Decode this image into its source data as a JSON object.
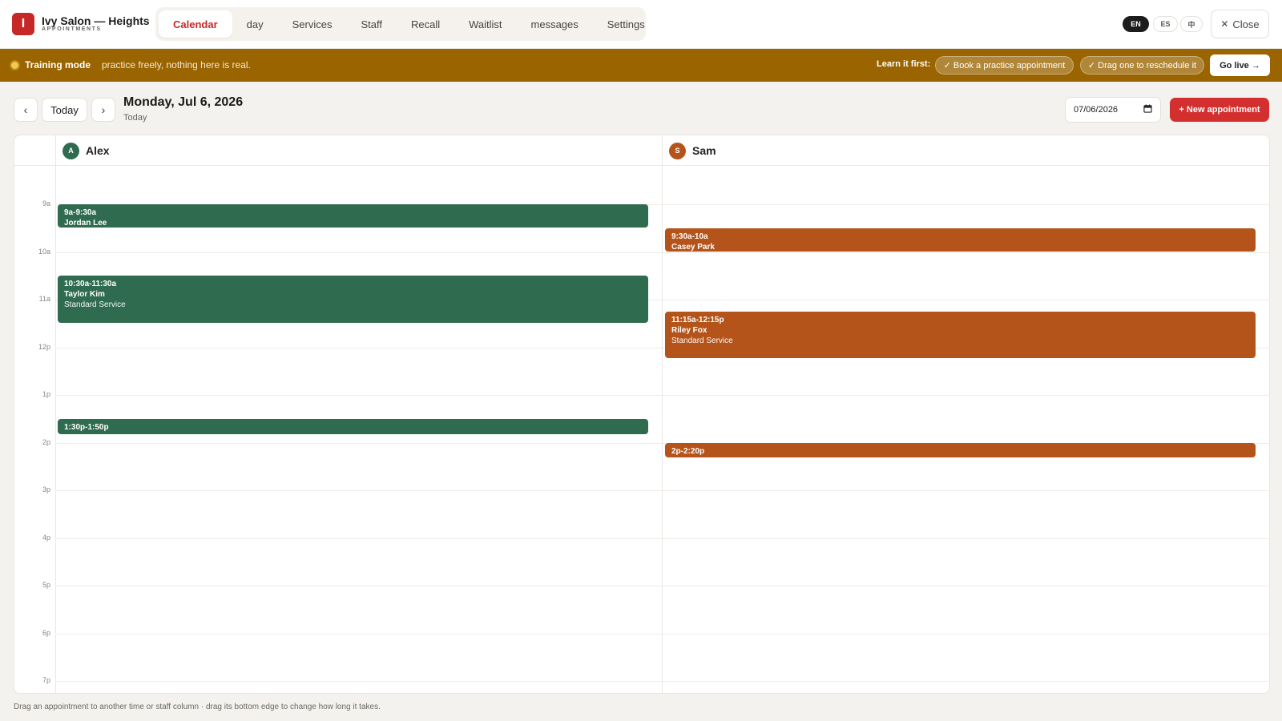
{
  "header": {
    "logo_letter": "I",
    "brand_name": "Ivy Salon — Heights",
    "brand_sub": "APPOINTMENTS",
    "tabs": [
      {
        "label": "Calendar"
      },
      {
        "label": "day"
      },
      {
        "label": "Services"
      },
      {
        "label": "Staff"
      },
      {
        "label": "Recall"
      },
      {
        "label": "Waitlist"
      },
      {
        "label": "messages"
      },
      {
        "label": "Settings"
      }
    ],
    "active_tab": "Calendar",
    "languages": [
      "EN",
      "ES",
      "中"
    ],
    "active_language": "EN",
    "close_label": "Close"
  },
  "training": {
    "label": "Training mode",
    "message": "practice freely, nothing here is real.",
    "learn_label": "Learn it first:",
    "tasks": [
      "✓ Book a practice appointment",
      "✓ Drag one to reschedule it"
    ],
    "go_live_label": "Go live →"
  },
  "toolbar": {
    "prev_label": "‹",
    "today_label": "Today",
    "next_label": "›",
    "date_title": "Monday, Jul 6, 2026",
    "date_sub": "Today",
    "date_value": "07/06/2026",
    "new_appointment_label": "+ New appointment"
  },
  "calendar": {
    "hours": [
      "9a",
      "10a",
      "11a",
      "12p",
      "1p",
      "2p",
      "3p",
      "4p",
      "5p",
      "6p",
      "7p"
    ],
    "staff": [
      {
        "initial": "A",
        "name": "Alex",
        "color": "#2f6b4f"
      },
      {
        "initial": "S",
        "name": "Sam",
        "color": "#b4541b"
      }
    ],
    "appointments": [
      {
        "staff": 0,
        "start": 9.0,
        "end": 9.5,
        "time": "9a-9:30a",
        "client": "Jordan Lee",
        "service": ""
      },
      {
        "staff": 0,
        "start": 10.5,
        "end": 11.5,
        "time": "10:30a-11:30a",
        "client": "Taylor Kim",
        "service": "Standard Service"
      },
      {
        "staff": 0,
        "start": 13.5,
        "end": 13.833,
        "time": "1:30p-1:50p",
        "client": "",
        "service": ""
      },
      {
        "staff": 1,
        "start": 9.5,
        "end": 10.0,
        "time": "9:30a-10a",
        "client": "Casey Park",
        "service": ""
      },
      {
        "staff": 1,
        "start": 11.25,
        "end": 12.25,
        "time": "11:15a-12:15p",
        "client": "Riley Fox",
        "service": "Standard Service"
      },
      {
        "staff": 1,
        "start": 14.0,
        "end": 14.333,
        "time": "2p-2:20p",
        "client": "",
        "service": ""
      }
    ]
  },
  "footer_hint": "Drag an appointment to another time or staff column · drag its bottom edge to change how long it takes."
}
